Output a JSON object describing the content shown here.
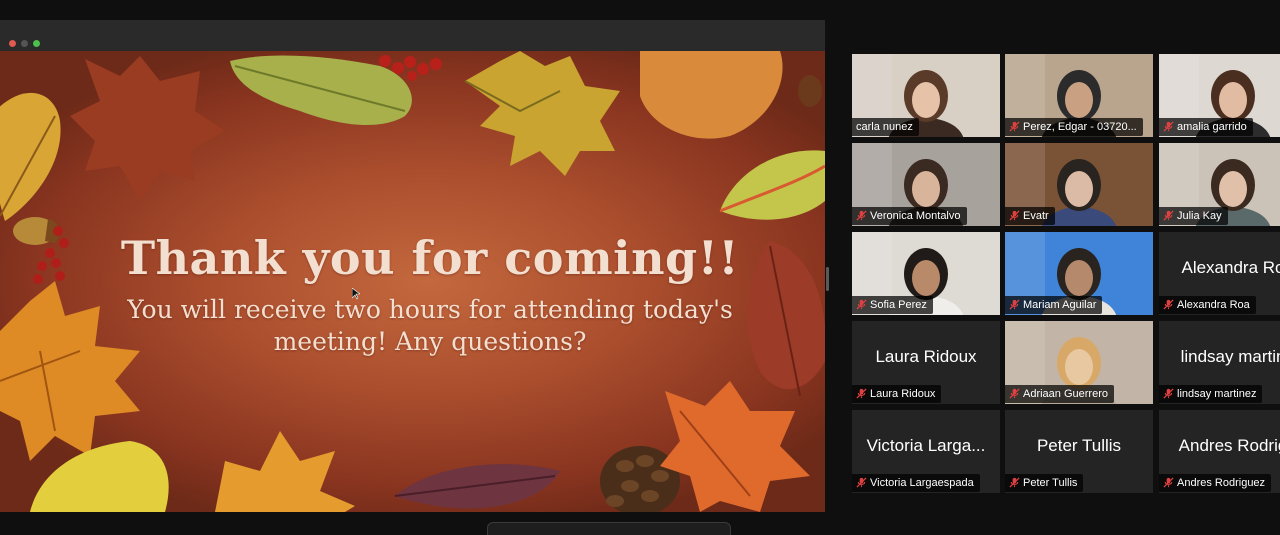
{
  "window_controls": [
    "close",
    "minimize",
    "zoom"
  ],
  "slide": {
    "title": "Thank you for coming!!",
    "body_line1": "You will receive two hours for attending today's",
    "body_line2": "meeting! Any questions?"
  },
  "colors": {
    "active_speaker_border": "#b7d86a",
    "muted_icon": "#e04040",
    "slide_background": "#a94d2d"
  },
  "participants": [
    {
      "name": "carla nunez",
      "label": "carla nunez",
      "video": true,
      "muted": false
    },
    {
      "name": "Perez, Edgar - 03720...",
      "label": "Perez, Edgar - 03720...",
      "video": true,
      "muted": true
    },
    {
      "name": "amalia garrido",
      "label": "amalia garrido",
      "video": true,
      "muted": true
    },
    {
      "name": "Veronica Montalvo",
      "label": "Veronica Montalvo",
      "video": true,
      "muted": true
    },
    {
      "name": "Evatr",
      "label": "Evatr",
      "video": true,
      "muted": true
    },
    {
      "name": "Julia Kay",
      "label": "Julia Kay",
      "video": true,
      "muted": true
    },
    {
      "name": "Sofia Perez",
      "label": "Sofia Perez",
      "video": true,
      "muted": true
    },
    {
      "name": "Mariam Aguilar",
      "label": "Mariam Aguilar",
      "video": true,
      "muted": true,
      "active": true
    },
    {
      "name": "Alexandra Roa",
      "label": "Alexandra Roa",
      "display": "Alexandra Ro",
      "video": false,
      "muted": true
    },
    {
      "name": "Laura Ridoux",
      "label": "Laura Ridoux",
      "display": "Laura Ridoux",
      "video": false,
      "muted": true
    },
    {
      "name": "Adriaan Guerrero",
      "label": "Adriaan Guerrero",
      "video": true,
      "muted": true
    },
    {
      "name": "lindsay martinez",
      "label": "lindsay martinez",
      "display": "lindsay martin",
      "video": false,
      "muted": true
    },
    {
      "name": "Victoria Largaespada",
      "label": "Victoria Largaespada",
      "display": "Victoria Larga...",
      "video": false,
      "muted": true
    },
    {
      "name": "Peter Tullis",
      "label": "Peter Tullis",
      "display": "Peter Tullis",
      "video": false,
      "muted": true
    },
    {
      "name": "Andres Rodriguez",
      "label": "Andres Rodriguez",
      "display": "Andres Rodrig",
      "video": false,
      "muted": true
    }
  ]
}
